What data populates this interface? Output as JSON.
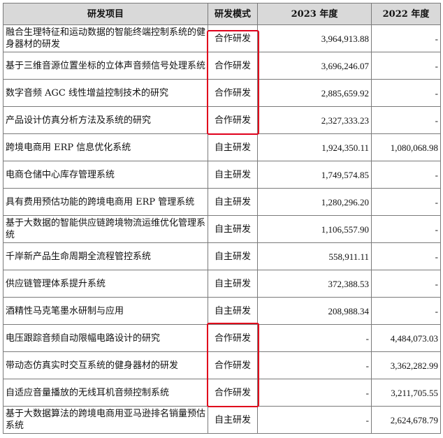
{
  "table": {
    "headers": [
      "研发项目",
      "研发模式",
      "2023 年度",
      "2022 年度"
    ],
    "rows": [
      {
        "name": "融合生理特征和运动数据的智能终端控制系统的健身器材的研发",
        "mode": "合作研发",
        "y2023": "3,964,913.88",
        "y2022": "-"
      },
      {
        "name": "基于三维音源位置坐标的立体声音频信号处理系统",
        "mode": "合作研发",
        "y2023": "3,696,246.07",
        "y2022": "-"
      },
      {
        "name": "数字音频 AGC 线性增益控制技术的研究",
        "mode": "合作研发",
        "y2023": "2,885,659.92",
        "y2022": "-"
      },
      {
        "name": "产品设计仿真分析方法及系统的研究",
        "mode": "合作研发",
        "y2023": "2,327,333.23",
        "y2022": "-"
      },
      {
        "name": "跨境电商用 ERP 信息优化系统",
        "mode": "自主研发",
        "y2023": "1,924,350.11",
        "y2022": "1,080,068.98"
      },
      {
        "name": "电商仓储中心库存管理系统",
        "mode": "自主研发",
        "y2023": "1,749,574.85",
        "y2022": "-"
      },
      {
        "name": "具有费用预估功能的跨境电商用 ERP 管理系统",
        "mode": "自主研发",
        "y2023": "1,280,296.20",
        "y2022": "-"
      },
      {
        "name": "基于大数据的智能供应链跨境物流运维优化管理系统",
        "mode": "自主研发",
        "y2023": "1,106,557.90",
        "y2022": "-"
      },
      {
        "name": "千岸新产品生命周期全流程管控系统",
        "mode": "自主研发",
        "y2023": "558,911.11",
        "y2022": "-"
      },
      {
        "name": "供应链管理体系提升系统",
        "mode": "自主研发",
        "y2023": "372,388.53",
        "y2022": "-"
      },
      {
        "name": "酒精性马克笔墨水研制与应用",
        "mode": "自主研发",
        "y2023": "208,988.34",
        "y2022": "-"
      },
      {
        "name": "电压跟踪音频自动限幅电路设计的研究",
        "mode": "合作研发",
        "y2023": "-",
        "y2022": "4,484,073.03"
      },
      {
        "name": "带动态仿真实时交互系统的健身器材的研发",
        "mode": "合作研发",
        "y2023": "-",
        "y2022": "3,362,282.99"
      },
      {
        "name": "自适应音量播放的无线耳机音频控制系统",
        "mode": "合作研发",
        "y2023": "-",
        "y2022": "3,211,705.55"
      },
      {
        "name": "基于大数据算法的跨境电商用亚马逊排名销量预估系统",
        "mode": "自主研发",
        "y2023": "-",
        "y2022": "2,624,678.79"
      }
    ]
  },
  "colors": {
    "header_bg": "#d9d9d9",
    "highlight": "#e0001b",
    "border": "#7a7a7a"
  }
}
